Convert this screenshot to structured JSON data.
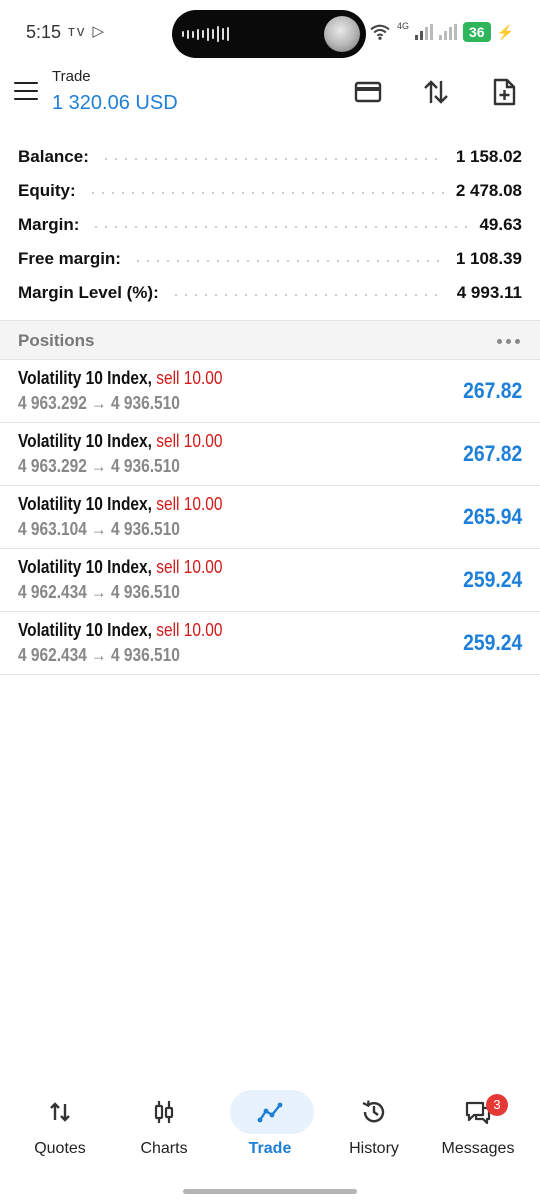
{
  "status_bar": {
    "time": "5:15",
    "left_icons": "ᴛᴠ ▷",
    "network_label": "4G",
    "battery": "36",
    "charging": "⚡"
  },
  "header": {
    "title": "Trade",
    "balance": "1 320.06 USD",
    "icons": [
      "menu-icon",
      "card-icon",
      "sort-arrows-icon",
      "new-order-icon"
    ]
  },
  "summary": [
    {
      "label": "Balance:",
      "value": "1 158.02"
    },
    {
      "label": "Equity:",
      "value": "2 478.08"
    },
    {
      "label": "Margin:",
      "value": "49.63"
    },
    {
      "label": "Free margin:",
      "value": "1 108.39"
    },
    {
      "label": "Margin Level (%):",
      "value": "4 993.11"
    }
  ],
  "positions": {
    "title": "Positions",
    "items": [
      {
        "symbol": "Volatility 10 Index,",
        "type": "sell 10.00",
        "open": "4 963.292",
        "arrow": "→",
        "current": "4 936.510",
        "profit": "267.82"
      },
      {
        "symbol": "Volatility 10 Index,",
        "type": "sell 10.00",
        "open": "4 963.292",
        "arrow": "→",
        "current": "4 936.510",
        "profit": "267.82"
      },
      {
        "symbol": "Volatility 10 Index,",
        "type": "sell 10.00",
        "open": "4 963.104",
        "arrow": "→",
        "current": "4 936.510",
        "profit": "265.94"
      },
      {
        "symbol": "Volatility 10 Index,",
        "type": "sell 10.00",
        "open": "4 962.434",
        "arrow": "→",
        "current": "4 936.510",
        "profit": "259.24"
      },
      {
        "symbol": "Volatility 10 Index,",
        "type": "sell 10.00",
        "open": "4 962.434",
        "arrow": "→",
        "current": "4 936.510",
        "profit": "259.24"
      }
    ]
  },
  "nav": {
    "items": [
      {
        "label": "Quotes",
        "icon": "quotes-icon"
      },
      {
        "label": "Charts",
        "icon": "charts-icon"
      },
      {
        "label": "Trade",
        "icon": "trade-icon",
        "active": true
      },
      {
        "label": "History",
        "icon": "history-icon"
      },
      {
        "label": "Messages",
        "icon": "messages-icon",
        "badge": "3"
      }
    ]
  },
  "colors": {
    "accent": "#1e7fd8",
    "sell": "#d21a1a",
    "badge": "#e53935",
    "battery": "#2fb55c"
  }
}
